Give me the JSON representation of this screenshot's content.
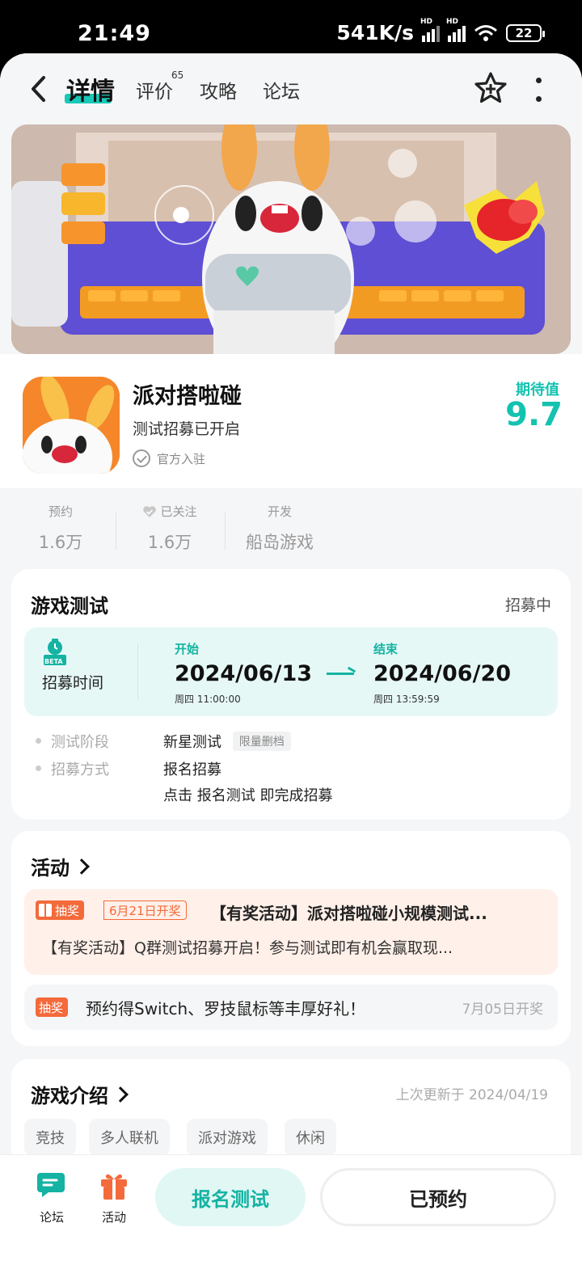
{
  "status_bar": {
    "time": "21:49",
    "speed": "541K/s",
    "net1": "HD",
    "net2": "HD",
    "battery": "22"
  },
  "nav": {
    "tabs": [
      {
        "label": "详情",
        "active": true
      },
      {
        "label": "评价",
        "badge": "65"
      },
      {
        "label": "攻略"
      },
      {
        "label": "论坛"
      }
    ],
    "icons": [
      "back-arrow-icon",
      "star-plus-icon",
      "more-vertical-icon"
    ]
  },
  "game": {
    "name": "派对搭啦碰",
    "subtitle": "测试招募已开启",
    "official": "官方入驻",
    "expect_label": "期待值",
    "expect_value": "9.7"
  },
  "stats": [
    {
      "label": "预约",
      "value": "1.6万"
    },
    {
      "label": "已关注",
      "value": "1.6万",
      "icon": "heart-check-icon"
    },
    {
      "label": "开发",
      "value": "船岛游戏"
    }
  ],
  "test": {
    "title": "游戏测试",
    "status": "招募中",
    "recruit_label": "招募时间",
    "beta_badge": "BETA",
    "start_head": "开始",
    "start_date": "2024/06/13",
    "start_time": "周四  11:00:00",
    "end_head": "结束",
    "end_date": "2024/06/20",
    "end_time": "周四  13:59:59",
    "phase_key": "测试阶段",
    "phase_val": "新星测试",
    "phase_tag": "限量删档",
    "method_key": "招募方式",
    "method_val": "报名招募",
    "method_note": "点击 报名测试 即完成招募"
  },
  "activity": {
    "title": "活动",
    "items": [
      {
        "tag": "抽奖",
        "date_tag": "6月21日开奖",
        "title": "【有奖活动】派对搭啦碰小规模测试...",
        "desc": "【有奖活动】Q群测试招募开启！参与测试即有机会赢取现..."
      },
      {
        "tag": "抽奖",
        "title": "预约得Switch、罗技鼠标等丰厚好礼！",
        "date": "7月05日开奖"
      }
    ]
  },
  "intro": {
    "title": "游戏介绍",
    "updated": "上次更新于 2024/04/19",
    "genres": [
      "竞技",
      "多人联机",
      "派对游戏",
      "休闲"
    ]
  },
  "bottom": {
    "forum": "论坛",
    "activity": "活动",
    "signup": "报名测试",
    "reserved": "已预约"
  },
  "colors": {
    "accent": "#14c2b0",
    "orange": "#f46a3a"
  }
}
